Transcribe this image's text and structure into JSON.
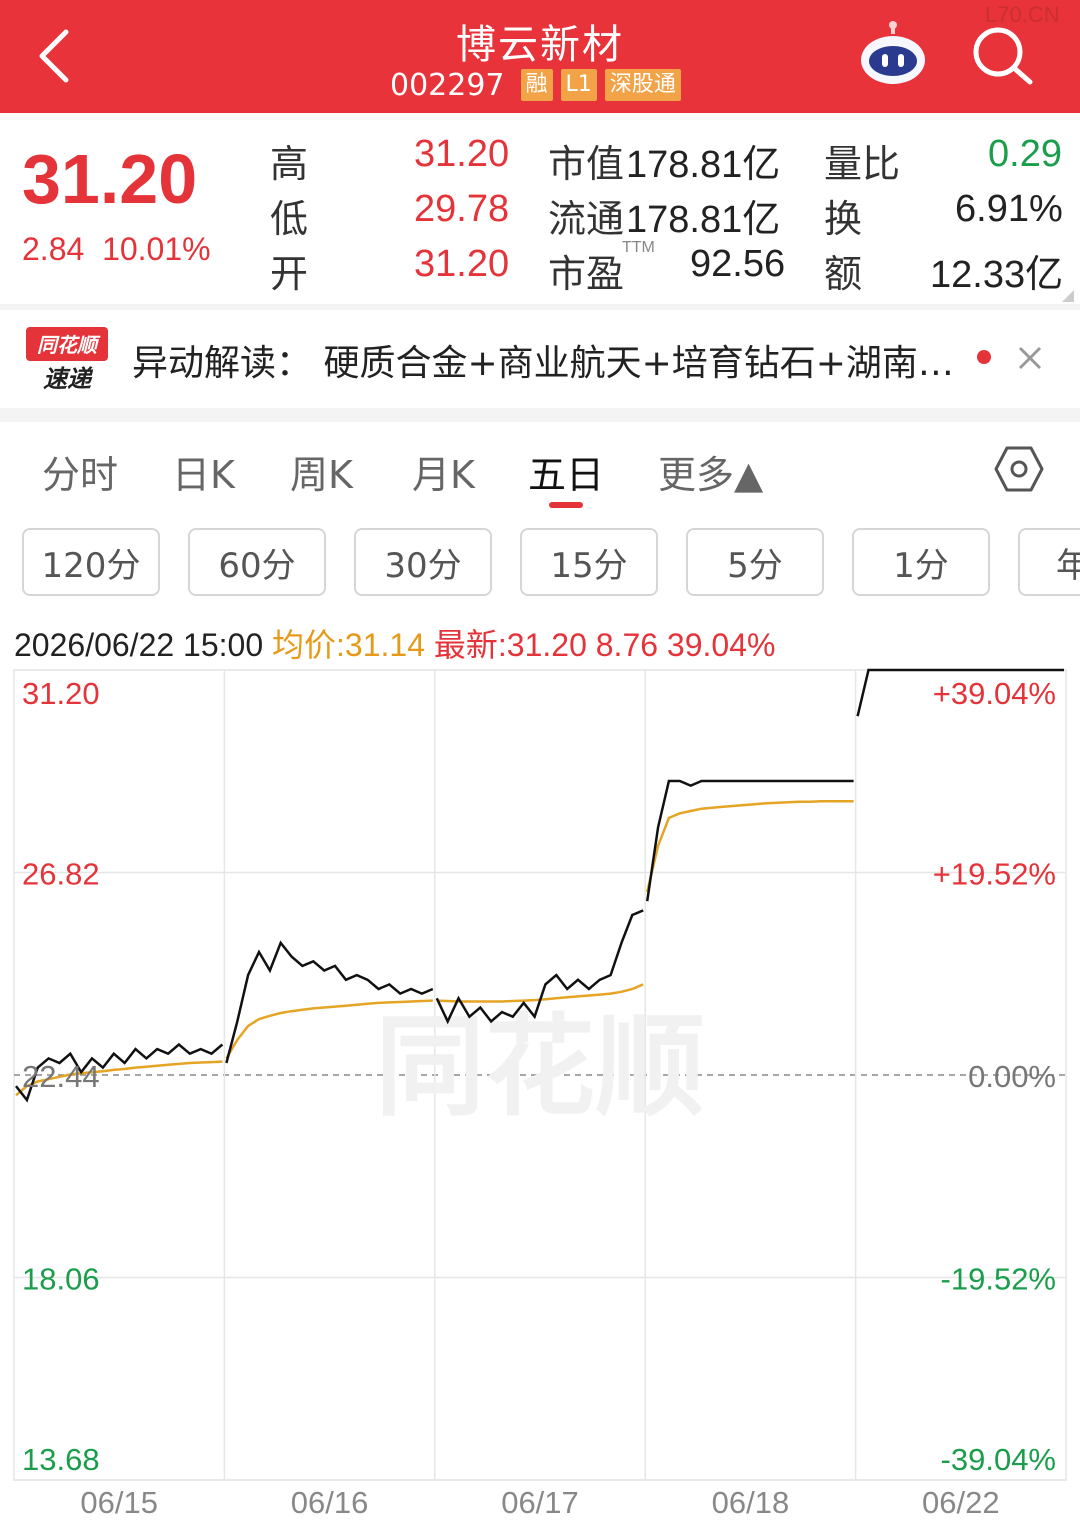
{
  "header": {
    "title": "博云新材",
    "code": "002297",
    "tags": [
      "融",
      "L1",
      "深股通"
    ],
    "watermark": "L70.CN"
  },
  "quote": {
    "price": "31.20",
    "change": "2.84",
    "change_pct": "10.01%",
    "rows": [
      {
        "l1": "高",
        "v1": "31.20",
        "l2": "市值",
        "v2": "178.81亿",
        "l3": "量比",
        "v3": "0.29"
      },
      {
        "l1": "低",
        "v1": "29.78",
        "l2": "流通",
        "v2": "178.81亿",
        "l3": "换",
        "v3": "6.91%"
      },
      {
        "l1": "开",
        "v1": "31.20",
        "l2": "市盈",
        "v2": "92.56",
        "l3": "额",
        "v3": "12.33亿"
      }
    ],
    "pe_suffix": "TTM"
  },
  "news": {
    "logo_top": "同花顺",
    "logo_bottom": "速递",
    "text": "异动解读：  硬质合金+商业航天+培育钻石+湖南…"
  },
  "tabs": [
    {
      "label": "分时"
    },
    {
      "label": "日K"
    },
    {
      "label": "周K"
    },
    {
      "label": "月K"
    },
    {
      "label": "五日"
    },
    {
      "label": "更多▲"
    }
  ],
  "periods": [
    "120分",
    "60分",
    "30分",
    "15分",
    "5分",
    "1分",
    "年"
  ],
  "info": {
    "datetime": "2026/06/22 15:00",
    "avg": "均价:31.14",
    "latest": "最新:31.20 8.76 39.04%"
  },
  "chart_data": {
    "type": "line",
    "title": "",
    "y_left_ticks": [
      "31.20",
      "26.82",
      "22.44",
      "18.06",
      "13.68"
    ],
    "y_right_ticks": [
      "+39.04%",
      "+19.52%",
      "0.00%",
      "-19.52%",
      "-39.04%"
    ],
    "ylim": [
      13.68,
      31.2
    ],
    "base": 22.44,
    "x_tick_labels": [
      "06/15",
      "06/16",
      "06/17",
      "06/18",
      "06/22"
    ],
    "brand_watermark": "同花顺",
    "days": [
      {
        "day": "06/15",
        "price": [
          22.2,
          21.9,
          22.6,
          22.8,
          22.7,
          22.9,
          22.5,
          22.8,
          22.6,
          22.9,
          22.7,
          23.0,
          22.8,
          23.0,
          22.9,
          23.1,
          22.9,
          23.0,
          22.9,
          23.1
        ],
        "avg": [
          22.0,
          22.2,
          22.3,
          22.35,
          22.4,
          22.45,
          22.48,
          22.5,
          22.52,
          22.55,
          22.57,
          22.6,
          22.62,
          22.64,
          22.66,
          22.68,
          22.7,
          22.71,
          22.72,
          22.73
        ]
      },
      {
        "day": "06/16",
        "price": [
          22.7,
          23.6,
          24.6,
          25.1,
          24.7,
          25.3,
          25.0,
          24.8,
          24.9,
          24.7,
          24.8,
          24.5,
          24.6,
          24.5,
          24.3,
          24.4,
          24.2,
          24.3,
          24.2,
          24.3
        ],
        "avg": [
          22.8,
          23.2,
          23.5,
          23.65,
          23.72,
          23.78,
          23.82,
          23.85,
          23.88,
          23.9,
          23.92,
          23.94,
          23.96,
          23.98,
          24.0,
          24.01,
          24.02,
          24.03,
          24.04,
          24.05
        ]
      },
      {
        "day": "06/17",
        "price": [
          24.1,
          23.6,
          24.1,
          23.7,
          23.9,
          23.6,
          23.8,
          23.7,
          24.0,
          23.7,
          24.4,
          24.6,
          24.3,
          24.5,
          24.3,
          24.5,
          24.6,
          25.3,
          25.9,
          26.0
        ],
        "avg": [
          24.05,
          24.04,
          24.03,
          24.03,
          24.03,
          24.03,
          24.03,
          24.04,
          24.05,
          24.06,
          24.08,
          24.1,
          24.12,
          24.14,
          24.16,
          24.18,
          24.2,
          24.24,
          24.3,
          24.4
        ]
      },
      {
        "day": "06/18",
        "price": [
          26.2,
          27.8,
          28.8,
          28.8,
          28.7,
          28.8,
          28.8,
          28.8,
          28.8,
          28.8,
          28.8,
          28.8,
          28.8,
          28.8,
          28.8,
          28.8,
          28.8,
          28.8,
          28.8,
          28.8
        ],
        "avg": [
          26.4,
          27.4,
          28.0,
          28.1,
          28.15,
          28.2,
          28.22,
          28.24,
          28.26,
          28.28,
          28.3,
          28.32,
          28.33,
          28.34,
          28.35,
          28.35,
          28.36,
          28.36,
          28.36,
          28.36
        ]
      },
      {
        "day": "06/22",
        "price": [
          30.2,
          31.2,
          31.2,
          31.2,
          31.2,
          31.2,
          31.2,
          31.2,
          31.2,
          31.2,
          31.2,
          31.2,
          31.2,
          31.2,
          31.2,
          31.2,
          31.2,
          31.2,
          31.2,
          31.2
        ],
        "avg": []
      }
    ],
    "colors": {
      "price": "#111111",
      "avg": "#e5a424",
      "up": "#e5333a",
      "down": "#1b9e4b",
      "grid": "#e6e6e6"
    }
  }
}
